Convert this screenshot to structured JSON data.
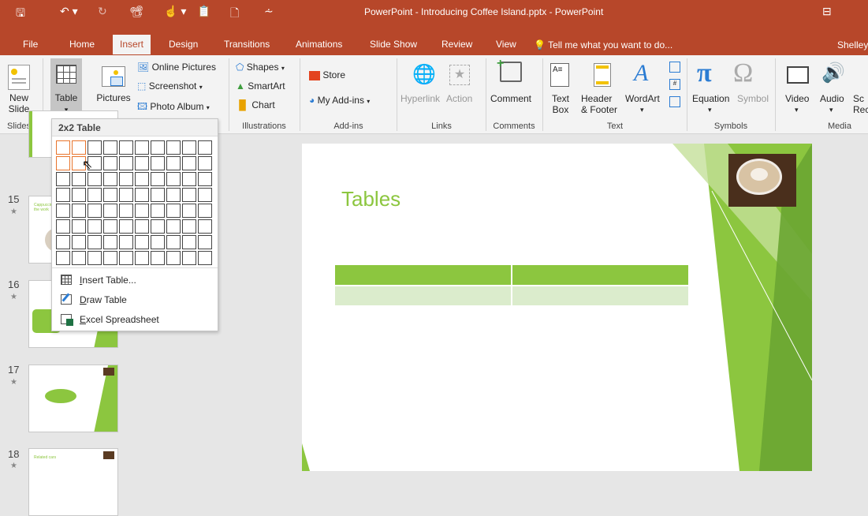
{
  "titlebar": {
    "title": "PowerPoint - Introducing Coffee Island.pptx - PowerPoint"
  },
  "tabs": [
    {
      "label": "File"
    },
    {
      "label": "Home"
    },
    {
      "label": "Insert"
    },
    {
      "label": "Design"
    },
    {
      "label": "Transitions"
    },
    {
      "label": "Animations"
    },
    {
      "label": "Slide Show"
    },
    {
      "label": "Review"
    },
    {
      "label": "View"
    }
  ],
  "tellme": "Tell me what you want to do...",
  "user": "Shelley",
  "ribbon": {
    "new_slide": "New\nSlide",
    "slides_group": "Slides",
    "table": "Table",
    "pictures": "Pictures",
    "online_pictures": "Online Pictures",
    "screenshot": "Screenshot",
    "photo_album": "Photo Album",
    "shapes": "Shapes",
    "smartart": "SmartArt",
    "chart": "Chart",
    "illustrations_group": "Illustrations",
    "store": "Store",
    "my_addins": "My Add-ins",
    "addins_group": "Add-ins",
    "hyperlink": "Hyperlink",
    "action": "Action",
    "links_group": "Links",
    "comment": "Comment",
    "comments_group": "Comments",
    "text_box": "Text\nBox",
    "header_footer": "Header\n& Footer",
    "wordart": "WordArt",
    "text_group": "Text",
    "equation": "Equation",
    "symbol": "Symbol",
    "symbols_group": "Symbols",
    "video": "Video",
    "audio": "Audio",
    "screen_rec": "Sc\nRec",
    "media_group": "Media"
  },
  "dropdown": {
    "header": "2x2 Table",
    "grid_cols": 10,
    "grid_rows": 8,
    "selected_cols": 2,
    "selected_rows": 2,
    "items": [
      {
        "label": "Insert Table...",
        "accel": "I",
        "rest": "nsert Table..."
      },
      {
        "label": "Draw Table",
        "accel": "D",
        "rest": "raw Table"
      },
      {
        "label": "Excel Spreadsheet",
        "accel": "E",
        "rest": "xcel Spreadsheet"
      }
    ]
  },
  "thumbnails": [
    {
      "num": "15",
      "text": "Cappuccino with the work"
    },
    {
      "num": "16",
      "text": ""
    },
    {
      "num": "17",
      "text": ""
    },
    {
      "num": "18",
      "text": "Related cars"
    }
  ],
  "slide": {
    "title": "Tables"
  },
  "colors": {
    "accent": "#b7472a",
    "green": "#8cc63f",
    "orange": "#e8742c"
  }
}
